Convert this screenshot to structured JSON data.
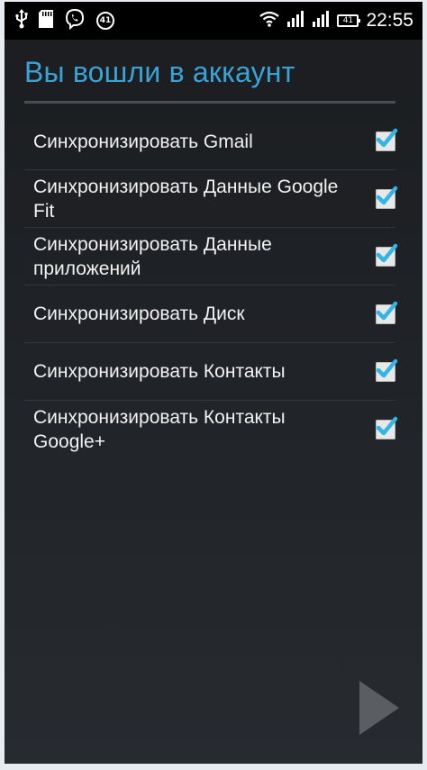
{
  "status_bar": {
    "notification_count": "41",
    "battery_level": "41",
    "time": "22:55",
    "icons": [
      "usb-icon",
      "sd-card-icon",
      "viber-icon",
      "notification-badge-icon",
      "wifi-icon",
      "signal-icon",
      "signal-icon-2",
      "battery-icon"
    ]
  },
  "page": {
    "title": "Вы вошли в аккаунт"
  },
  "sync_items": [
    {
      "label": "Синхронизировать Gmail",
      "checked": true
    },
    {
      "label": "Синхронизировать Данные Google Fit",
      "checked": true
    },
    {
      "label": "Синхронизировать Данные приложений",
      "checked": true
    },
    {
      "label": "Синхронизировать Диск",
      "checked": true
    },
    {
      "label": "Синхронизировать Контакты",
      "checked": true
    },
    {
      "label": "Синхронизировать Контакты Google+",
      "checked": true
    }
  ],
  "navigation": {
    "next_icon": "next-arrow-icon"
  },
  "colors": {
    "accent": "#3aa3d6",
    "checkmark": "#33b5e5",
    "background": "#1f2226"
  }
}
